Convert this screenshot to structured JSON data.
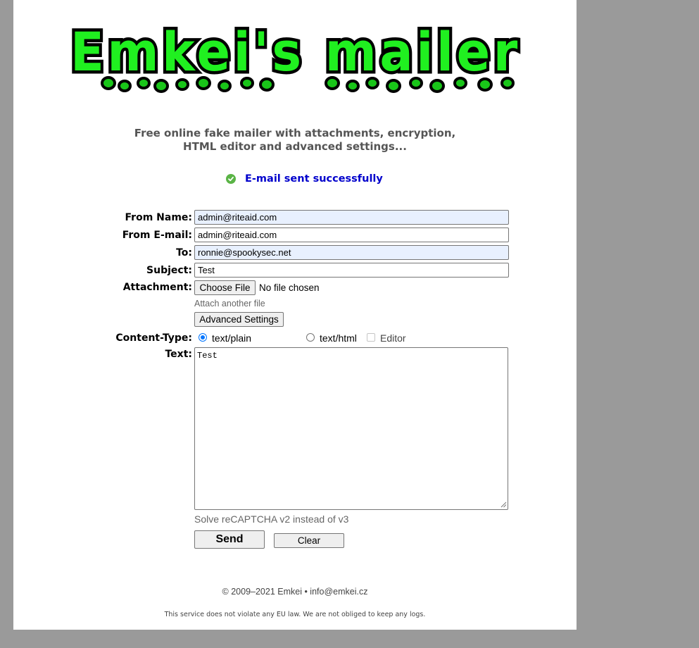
{
  "logo": {
    "text": "Emkei's mailer"
  },
  "tagline": {
    "line1": "Free online fake mailer with attachments, encryption,",
    "line2": "HTML editor and advanced settings..."
  },
  "status": {
    "message": "E-mail sent successfully",
    "icon": "check-circle-icon",
    "color": "#0000cc"
  },
  "form": {
    "from_name": {
      "label": "From Name:",
      "value": "admin@riteaid.com"
    },
    "from_email": {
      "label": "From E-mail:",
      "value": "admin@riteaid.com"
    },
    "to": {
      "label": "To:",
      "value": "ronnie@spookysec.net"
    },
    "subject": {
      "label": "Subject:",
      "value": "Test"
    },
    "attachment": {
      "label": "Attachment:",
      "button": "Choose File",
      "status": "No file chosen",
      "attach_another": "Attach another file"
    },
    "advanced_settings": "Advanced Settings",
    "content_type": {
      "label": "Content-Type:",
      "options": [
        "text/plain",
        "text/html"
      ],
      "selected": "text/plain",
      "editor_label": "Editor"
    },
    "text": {
      "label": "Text:",
      "value": "Test"
    },
    "captcha_link": "Solve reCAPTCHA v2 instead of v3",
    "send": "Send",
    "clear": "Clear"
  },
  "footer": {
    "copyright": "© 2009–2021 Emkei • info@emkei.cz",
    "disclaimer": "This service does not violate any EU law. We are not obliged to keep any logs."
  }
}
